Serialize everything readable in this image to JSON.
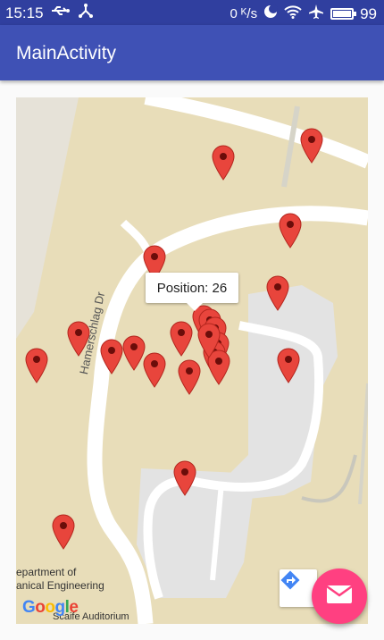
{
  "status_bar": {
    "time": "15:15",
    "speed": "0 ᴷ/s",
    "battery_level": "99",
    "battery_fraction": 0.99,
    "icons": [
      "usb-icon",
      "share-hub-icon",
      "moon-icon",
      "wifi-icon",
      "airplane-icon",
      "battery-icon"
    ]
  },
  "app_bar": {
    "title": "MainActivity"
  },
  "map": {
    "info_window": "Position: 26",
    "street_label": "Hamerschlag Dr",
    "place_labels": [
      "epartment of",
      "anical Engineering",
      "Scaife Auditorium"
    ],
    "google_letters": [
      "G",
      "o",
      "o",
      "g",
      "l",
      "e"
    ],
    "google_colors": [
      "#4285f4",
      "#ea4335",
      "#fbbc05",
      "#4285f4",
      "#34a853",
      "#ea4335"
    ],
    "marker_color": "#e8453c",
    "marker_count": 22
  },
  "fab": {
    "icon": "mail-icon",
    "color": "#ff4081"
  },
  "directions_button": {
    "icon": "directions-icon"
  }
}
